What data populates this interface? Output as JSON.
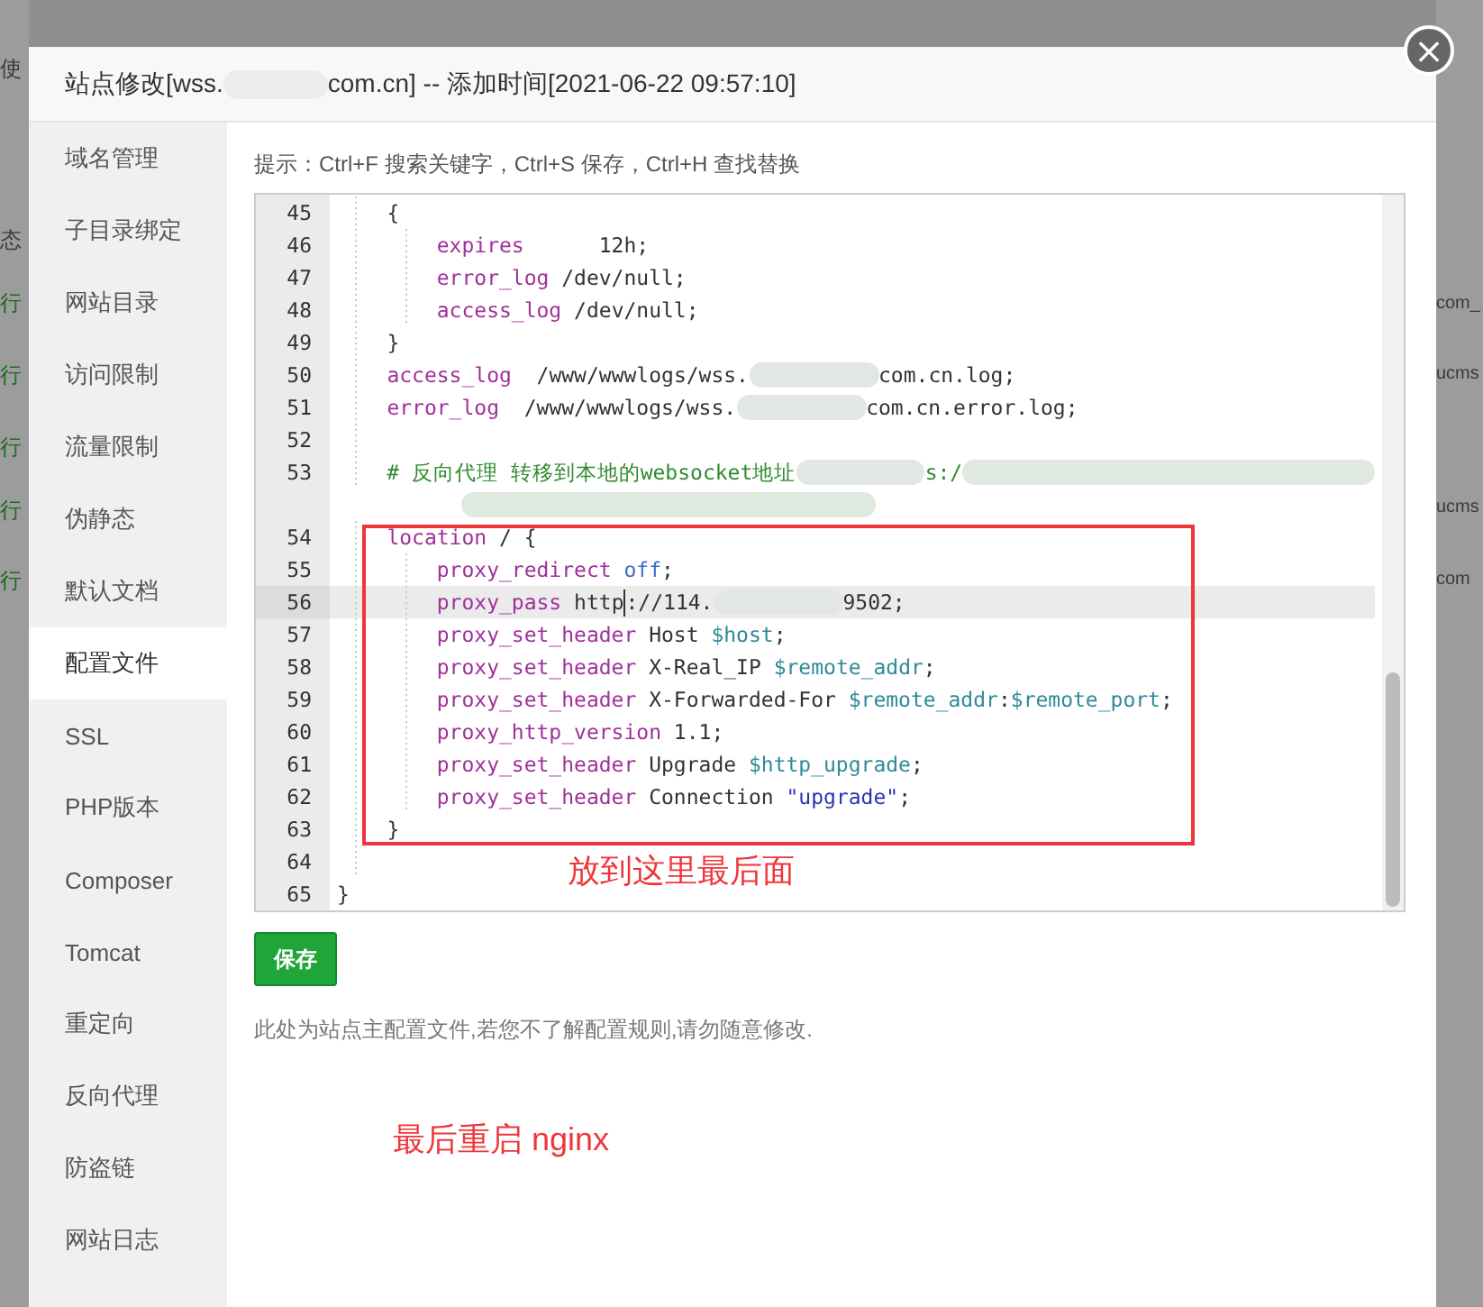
{
  "background_page": {
    "left_fragments": [
      "使",
      "态",
      "行",
      "行",
      "行",
      "行",
      "行"
    ],
    "right_fragments": [
      "com_",
      "ucms",
      "ucms",
      "com"
    ]
  },
  "dialog": {
    "title_parts": [
      "站点修改[wss.",
      "com.cn] -- 添加时间[2021-06-22 09:57:10]"
    ],
    "close_label": "×"
  },
  "sidebar": {
    "items": [
      {
        "label": "域名管理",
        "selected": false
      },
      {
        "label": "子目录绑定",
        "selected": false
      },
      {
        "label": "网站目录",
        "selected": false
      },
      {
        "label": "访问限制",
        "selected": false
      },
      {
        "label": "流量限制",
        "selected": false
      },
      {
        "label": "伪静态",
        "selected": false
      },
      {
        "label": "默认文档",
        "selected": false
      },
      {
        "label": "配置文件",
        "selected": true
      },
      {
        "label": "SSL",
        "selected": false
      },
      {
        "label": "PHP版本",
        "selected": false
      },
      {
        "label": "Composer",
        "selected": false
      },
      {
        "label": "Tomcat",
        "selected": false
      },
      {
        "label": "重定向",
        "selected": false
      },
      {
        "label": "反向代理",
        "selected": false
      },
      {
        "label": "防盗链",
        "selected": false
      },
      {
        "label": "网站日志",
        "selected": false
      }
    ]
  },
  "editor": {
    "hint": "提示：Ctrl+F 搜索关键字，Ctrl+S 保存，Ctrl+H 查找替换",
    "lines": [
      {
        "number": "45",
        "active": false,
        "tokens": [
          {
            "kind": "guide"
          },
          {
            "kind": "plain",
            "text": "{"
          }
        ]
      },
      {
        "number": "46",
        "active": false,
        "tokens": [
          {
            "kind": "guide"
          },
          {
            "kind": "guide"
          },
          {
            "kind": "keyword",
            "text": "expires"
          },
          {
            "kind": "plain",
            "text": "      12h;"
          }
        ]
      },
      {
        "number": "47",
        "active": false,
        "tokens": [
          {
            "kind": "guide"
          },
          {
            "kind": "guide"
          },
          {
            "kind": "keyword",
            "text": "error_log"
          },
          {
            "kind": "plain",
            "text": " /dev/null;"
          }
        ]
      },
      {
        "number": "48",
        "active": false,
        "tokens": [
          {
            "kind": "guide"
          },
          {
            "kind": "guide"
          },
          {
            "kind": "keyword",
            "text": "access_log"
          },
          {
            "kind": "plain",
            "text": " /dev/null;"
          }
        ]
      },
      {
        "number": "49",
        "active": false,
        "tokens": [
          {
            "kind": "guide"
          },
          {
            "kind": "plain",
            "text": "}"
          }
        ]
      },
      {
        "number": "50",
        "active": false,
        "tokens": [
          {
            "kind": "guide"
          },
          {
            "kind": "keyword",
            "text": "access_log"
          },
          {
            "kind": "plain",
            "text": "  /www/wwwlogs/wss."
          },
          {
            "kind": "redacted"
          },
          {
            "kind": "plain",
            "text": "com.cn.log;"
          }
        ]
      },
      {
        "number": "51",
        "active": false,
        "tokens": [
          {
            "kind": "guide"
          },
          {
            "kind": "keyword",
            "text": "error_log"
          },
          {
            "kind": "plain",
            "text": "  /www/wwwlogs/wss."
          },
          {
            "kind": "redacted"
          },
          {
            "kind": "plain",
            "text": "com.cn.error.log;"
          }
        ]
      },
      {
        "number": "52",
        "active": false,
        "tokens": [
          {
            "kind": "guide"
          }
        ]
      },
      {
        "number": "53",
        "active": false,
        "tokens": [
          {
            "kind": "guide"
          },
          {
            "kind": "comment",
            "text": "# 反向代理 转移到本地的websocket地址"
          },
          {
            "kind": "redacted"
          },
          {
            "kind": "comment",
            "text": "s:/"
          },
          {
            "kind": "redacted_long"
          },
          {
            "kind": "wrap"
          },
          {
            "kind": "redacted_long"
          }
        ]
      },
      {
        "number": "54",
        "active": false,
        "tokens": [
          {
            "kind": "guide"
          },
          {
            "kind": "keyword",
            "text": "location"
          },
          {
            "kind": "plain",
            "text": " / {"
          }
        ]
      },
      {
        "number": "55",
        "active": false,
        "tokens": [
          {
            "kind": "guide"
          },
          {
            "kind": "guide"
          },
          {
            "kind": "keyword",
            "text": "proxy_redirect"
          },
          {
            "kind": "space"
          },
          {
            "kind": "atom",
            "text": "off"
          },
          {
            "kind": "plain",
            "text": ";"
          }
        ]
      },
      {
        "number": "56",
        "active": true,
        "tokens": [
          {
            "kind": "guide"
          },
          {
            "kind": "guide"
          },
          {
            "kind": "keyword",
            "text": "proxy_pass"
          },
          {
            "kind": "plain",
            "text": " http"
          },
          {
            "kind": "cursor"
          },
          {
            "kind": "plain",
            "text": "://114."
          },
          {
            "kind": "redacted"
          },
          {
            "kind": "plain",
            "text": "9502;"
          }
        ]
      },
      {
        "number": "57",
        "active": false,
        "tokens": [
          {
            "kind": "guide"
          },
          {
            "kind": "guide"
          },
          {
            "kind": "keyword",
            "text": "proxy_set_header"
          },
          {
            "kind": "plain",
            "text": " Host "
          },
          {
            "kind": "variable",
            "text": "$host"
          },
          {
            "kind": "plain",
            "text": ";"
          }
        ]
      },
      {
        "number": "58",
        "active": false,
        "tokens": [
          {
            "kind": "guide"
          },
          {
            "kind": "guide"
          },
          {
            "kind": "keyword",
            "text": "proxy_set_header"
          },
          {
            "kind": "plain",
            "text": " X-Real_IP "
          },
          {
            "kind": "variable",
            "text": "$remote_addr"
          },
          {
            "kind": "plain",
            "text": ";"
          }
        ]
      },
      {
        "number": "59",
        "active": false,
        "tokens": [
          {
            "kind": "guide"
          },
          {
            "kind": "guide"
          },
          {
            "kind": "keyword",
            "text": "proxy_set_header"
          },
          {
            "kind": "plain",
            "text": " X-Forwarded-For "
          },
          {
            "kind": "variable",
            "text": "$remote_addr"
          },
          {
            "kind": "plain",
            "text": ":"
          },
          {
            "kind": "variable",
            "text": "$remote_port"
          },
          {
            "kind": "plain",
            "text": ";"
          }
        ]
      },
      {
        "number": "60",
        "active": false,
        "tokens": [
          {
            "kind": "guide"
          },
          {
            "kind": "guide"
          },
          {
            "kind": "keyword",
            "text": "proxy_http_version"
          },
          {
            "kind": "plain",
            "text": " 1.1;"
          }
        ]
      },
      {
        "number": "61",
        "active": false,
        "tokens": [
          {
            "kind": "guide"
          },
          {
            "kind": "guide"
          },
          {
            "kind": "keyword",
            "text": "proxy_set_header"
          },
          {
            "kind": "plain",
            "text": " Upgrade "
          },
          {
            "kind": "variable",
            "text": "$http_upgrade"
          },
          {
            "kind": "plain",
            "text": ";"
          }
        ]
      },
      {
        "number": "62",
        "active": false,
        "tokens": [
          {
            "kind": "guide"
          },
          {
            "kind": "guide"
          },
          {
            "kind": "keyword",
            "text": "proxy_set_header"
          },
          {
            "kind": "plain",
            "text": " Connection "
          },
          {
            "kind": "string",
            "text": "\"upgrade\""
          },
          {
            "kind": "plain",
            "text": ";"
          }
        ]
      },
      {
        "number": "63",
        "active": false,
        "tokens": [
          {
            "kind": "guide"
          },
          {
            "kind": "plain",
            "text": "}"
          }
        ]
      },
      {
        "number": "64",
        "active": false,
        "tokens": [
          {
            "kind": "guide"
          }
        ]
      },
      {
        "number": "65",
        "active": false,
        "tokens": [
          {
            "kind": "plain",
            "text": "}"
          }
        ]
      }
    ],
    "save_button": "保存",
    "note": "此处为站点主配置文件,若您不了解配置规则,请勿随意修改."
  },
  "annotations": {
    "frame_label": "放到这里最后面",
    "footer_note": "最后重启 nginx"
  }
}
